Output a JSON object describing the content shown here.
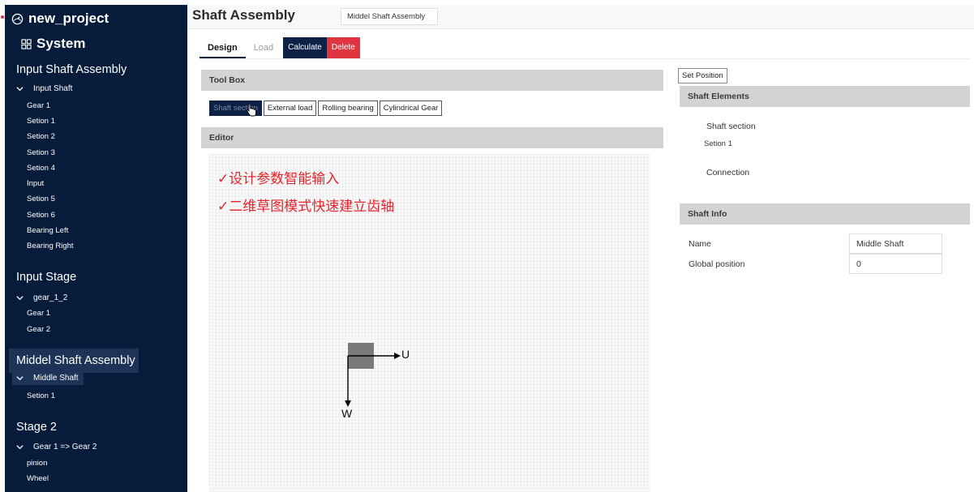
{
  "project": {
    "name": "new_project",
    "system_label": "System"
  },
  "sidebar": {
    "groups": [
      {
        "title": "Input Shaft Assembly",
        "node": "Input Shaft",
        "items": [
          "Gear 1",
          "Setion 1",
          "Setion 2",
          "Setion 3",
          "Setion 4",
          "Input",
          "Setion 5",
          "Setion 6",
          "Bearing Left",
          "Bearing Right"
        ]
      },
      {
        "title": "Input Stage",
        "node": "gear_1_2",
        "items": [
          "Gear 1",
          "Gear 2"
        ]
      },
      {
        "title": "Middel Shaft Assembly",
        "node": "Middle Shaft",
        "items": [
          "Setion 1"
        ]
      },
      {
        "title": "Stage 2",
        "node": "Gear 1 => Gear 2",
        "items": [
          "pinion",
          "Wheel"
        ]
      }
    ]
  },
  "header": {
    "title": "Shaft Assembly",
    "assembly_name": "Middel Shaft Assembly"
  },
  "tabs": {
    "design": "Design",
    "load": "Load",
    "calculate": "Calculate",
    "delete": "Delete"
  },
  "toolbox": {
    "title": "Tool Box",
    "buttons": [
      "Shaft section",
      "External load",
      "Rolling bearing",
      "Cylindrical Gear"
    ]
  },
  "editor": {
    "title": "Editor",
    "notes": [
      "✓设计参数智能输入",
      "✓二维草图模式快速建立齿轴"
    ],
    "axis_u": "U",
    "axis_w": "W"
  },
  "right_panel": {
    "set_position": "Set Position",
    "elements_title": "Shaft Elements",
    "shaft_section_label": "Shaft section",
    "shaft_section_item": "Setion 1",
    "connection_label": "Connection",
    "info_title": "Shaft Info",
    "name_label": "Name",
    "name_value": "Middle Shaft",
    "position_label": "Global position",
    "position_value": "0"
  },
  "colors": {
    "sidebar_bg": "#071b3b",
    "accent_navy": "#0d2147",
    "danger": "#e03540",
    "note_red": "#e8232b",
    "panel_header": "#d3d3d3"
  }
}
